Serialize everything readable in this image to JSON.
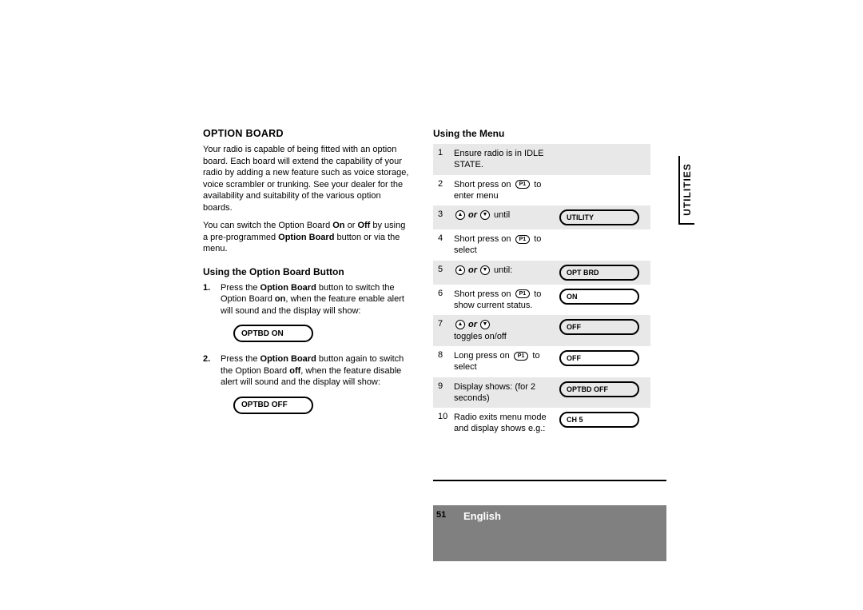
{
  "sidebar": {
    "label": "UTILITIES"
  },
  "footer": {
    "page": "51",
    "language": "English"
  },
  "left": {
    "heading": "OPTION BOARD",
    "para1_a": "Your radio is capable of being fitted with an option board. Each board will extend the capability of your radio by adding a new feature such as voice storage, voice scrambler or trunking. See your dealer for the availability and suitability of the various option boards.",
    "para2_a": "You can switch the Option Board ",
    "para2_b": "On",
    "para2_c": " or ",
    "para2_d": "Off",
    "para2_e": " by using a pre-programmed ",
    "para2_f": "Option Board",
    "para2_g": " button or via the menu.",
    "sub1": "Using the Option Board Button",
    "step1_num": "1.",
    "step1_a": "Press the ",
    "step1_b": "Option Board",
    "step1_c": " button to switch the Option Board ",
    "step1_d": "on",
    "step1_e": ", when the feature enable alert will sound and the display will show:",
    "disp1": "OPTBD ON",
    "step2_num": "2.",
    "step2_a": "Press the ",
    "step2_b": "Option Board",
    "step2_c": " button again to switch the Option Board ",
    "step2_d": "off",
    "step2_e": ", when the feature disable alert  will sound and the display will show:",
    "disp2": "OPTBD OFF"
  },
  "right": {
    "heading": "Using the Menu",
    "rows": [
      {
        "num": "1",
        "desc": "Ensure radio is in IDLE STATE.",
        "display": ""
      },
      {
        "num": "2",
        "desc_pre": "Short press on ",
        "btn": "P1",
        "desc_post": " to enter menu",
        "display": ""
      },
      {
        "num": "3",
        "or_row": true,
        "tail": " until",
        "display": "UTILITY"
      },
      {
        "num": "4",
        "desc_pre": "Short press on ",
        "btn": "P1",
        "desc_post": "  to select",
        "display": ""
      },
      {
        "num": "5",
        "or_row": true,
        "tail": " until:",
        "display": "OPT BRD"
      },
      {
        "num": "6",
        "desc_pre": "Short press on ",
        "btn": "P1",
        "desc_post": " to show current status.",
        "display": "ON"
      },
      {
        "num": "7",
        "or_row": true,
        "tail": "",
        "line2": "toggles on/off",
        "display": "OFF"
      },
      {
        "num": "8",
        "desc_pre": "Long press on ",
        "btn": "P1",
        "desc_post": " to select",
        "display": "OFF"
      },
      {
        "num": "9",
        "plain": "Display shows: (for 2 seconds)",
        "display": "OPTBD OFF"
      },
      {
        "num": "10",
        "plain": "Radio exits menu mode and display shows e.g.:",
        "display": "CH 5"
      }
    ]
  }
}
